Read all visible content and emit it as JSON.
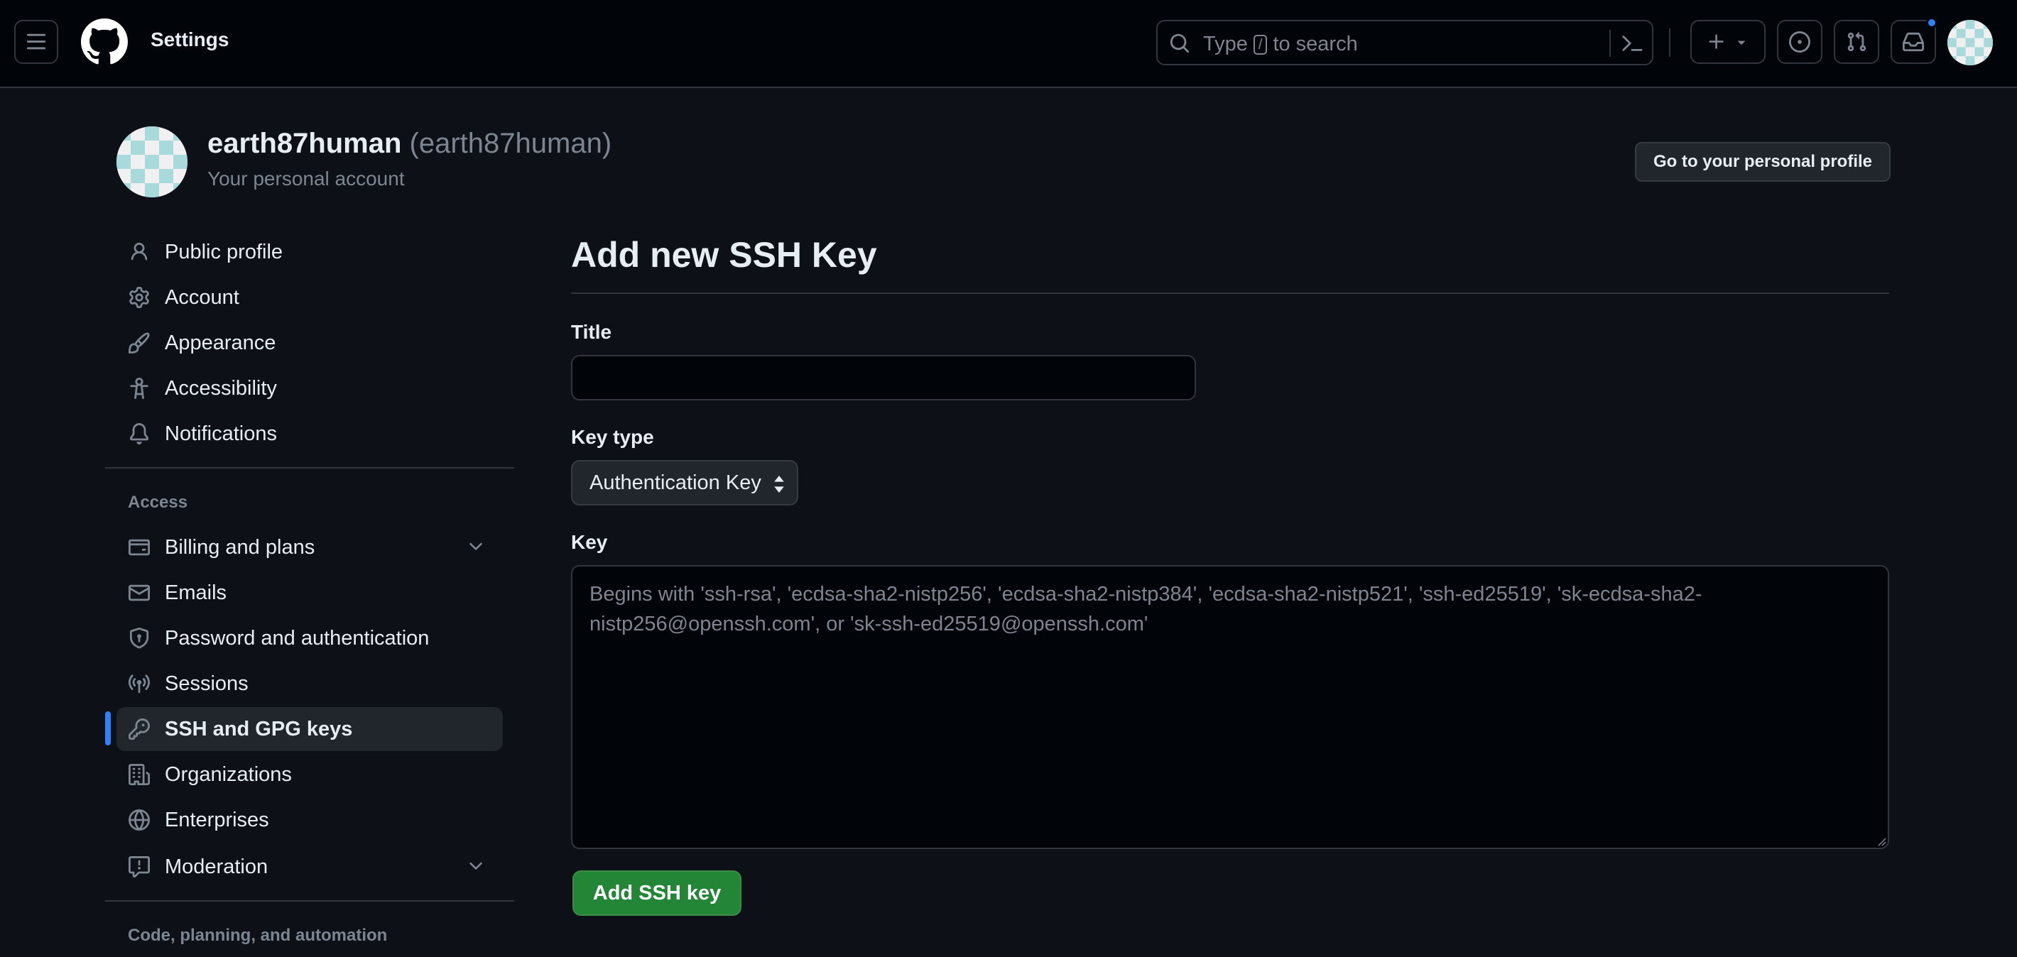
{
  "header": {
    "title": "Settings",
    "search": {
      "prefix": "Type",
      "key": "/",
      "suffix": "to search"
    }
  },
  "profile": {
    "login": "earth87human",
    "display": "(earth87human)",
    "subtitle": "Your personal account",
    "go_profile_label": "Go to your personal profile"
  },
  "sidebar": {
    "items": [
      {
        "label": "Public profile",
        "icon": "person-icon"
      },
      {
        "label": "Account",
        "icon": "gear-icon"
      },
      {
        "label": "Appearance",
        "icon": "paintbrush-icon"
      },
      {
        "label": "Accessibility",
        "icon": "accessibility-icon"
      },
      {
        "label": "Notifications",
        "icon": "bell-icon"
      }
    ],
    "access_heading": "Access",
    "access_items": [
      {
        "label": "Billing and plans",
        "icon": "credit-card-icon"
      },
      {
        "label": "Emails",
        "icon": "mail-icon"
      },
      {
        "label": "Password and authentication",
        "icon": "shield-lock-icon"
      },
      {
        "label": "Sessions",
        "icon": "broadcast-icon"
      },
      {
        "label": "SSH and GPG keys",
        "icon": "key-icon"
      },
      {
        "label": "Organizations",
        "icon": "organization-icon"
      },
      {
        "label": "Enterprises",
        "icon": "globe-icon"
      },
      {
        "label": "Moderation",
        "icon": "report-icon"
      }
    ],
    "code_heading": "Code, planning, and automation"
  },
  "form": {
    "heading": "Add new SSH Key",
    "title_label": "Title",
    "title_value": "",
    "key_type_label": "Key type",
    "key_type_value": "Authentication Key",
    "key_label": "Key",
    "key_placeholder": "Begins with 'ssh-rsa', 'ecdsa-sha2-nistp256', 'ecdsa-sha2-nistp384', 'ecdsa-sha2-nistp521', 'ssh-ed25519', 'sk-ecdsa-sha2-nistp256@openssh.com', or 'sk-ssh-ed25519@openssh.com'",
    "submit_label": "Add SSH key"
  },
  "colors": {
    "background": "#0d1117",
    "header_bg": "#010409",
    "accent_blue": "#2f81f7",
    "button_green": "#238636"
  }
}
